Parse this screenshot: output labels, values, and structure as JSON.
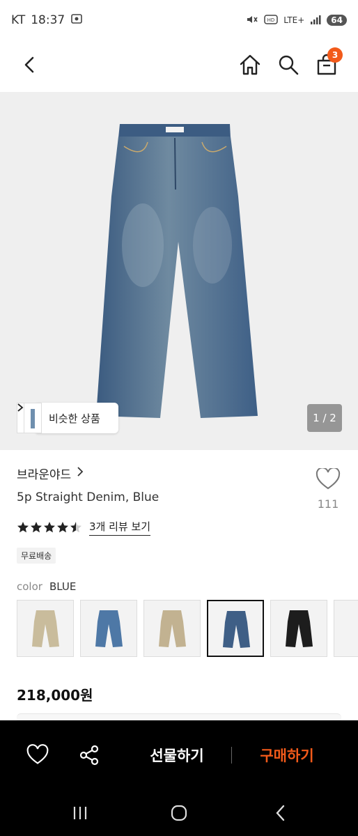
{
  "status_bar": {
    "carrier": "KT",
    "time": "18:37",
    "network": "LTE+",
    "battery": "64"
  },
  "header": {
    "cart_count": "3"
  },
  "gallery": {
    "similar_label": "비슷한 상품",
    "page_indicator": "1 / 2"
  },
  "product": {
    "brand": "브라운야드",
    "name": "5p Straight Denim, Blue",
    "wish_count": "111",
    "rating": 4.5,
    "review_link": "3개 리뷰 보기",
    "shipping_tag": "무료배송",
    "color_label": "color",
    "color_value": "BLUE",
    "price": "218,000원"
  },
  "swatches": [
    {
      "color": "#c9bc9c",
      "selected": false
    },
    {
      "color": "#4e78a6",
      "selected": false
    },
    {
      "color": "#c2b291",
      "selected": false
    },
    {
      "color": "#3f5f86",
      "selected": true
    },
    {
      "color": "#1d1d1d",
      "selected": false
    }
  ],
  "actions": {
    "gift_label": "선물하기",
    "buy_label": "구매하기"
  },
  "colors": {
    "accent": "#f25a1a",
    "bar_background": "#000000",
    "denim": "#4a6a8c"
  },
  "icons": [
    "back-icon",
    "home-icon",
    "search-icon",
    "shopping-bag-icon",
    "chevron-right-icon",
    "heart-icon",
    "star-icon",
    "share-icon",
    "recent-apps-icon",
    "home-circle-icon",
    "back-nav-icon"
  ]
}
